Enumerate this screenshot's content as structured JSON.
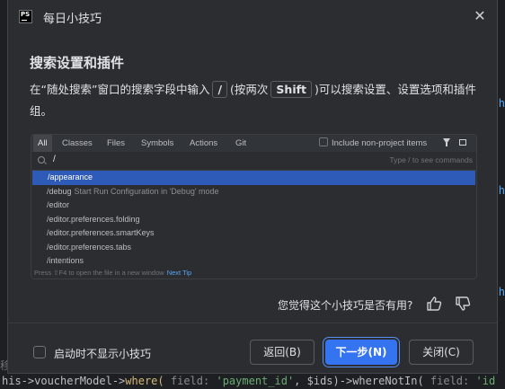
{
  "dialog": {
    "title": "每日小技巧",
    "app_logo": "PS",
    "close_icon": "close-icon"
  },
  "tip": {
    "heading": "搜索设置和插件",
    "desc_part1": "在“随处搜索”窗口的搜索字段中输入",
    "key_slash": "/",
    "desc_part2": "(按两次",
    "key_shift": "Shift",
    "desc_part3": ")可以搜索设置、设置选项和插件组。"
  },
  "preview": {
    "tabs": [
      "All",
      "Classes",
      "Files",
      "Symbols",
      "Actions",
      "Git"
    ],
    "include_label": "Include non-project items",
    "search_value": "/",
    "search_hint": "Type / to see commands",
    "results": [
      {
        "text": "/appearance",
        "sub": ""
      },
      {
        "text": "/debug",
        "sub": "Start Run Configuration in 'Debug' mode"
      },
      {
        "text": "/editor",
        "sub": ""
      },
      {
        "text": "/editor.preferences.folding",
        "sub": ""
      },
      {
        "text": "/editor.preferences.smartKeys",
        "sub": ""
      },
      {
        "text": "/editor.preferences.tabs",
        "sub": ""
      },
      {
        "text": "/intentions",
        "sub": ""
      }
    ],
    "footer_text": "Press ⇧F4 to open the file in a new window",
    "footer_link": "Next Tip"
  },
  "feedback": {
    "question": "您觉得这个小技巧是否有用?"
  },
  "footer": {
    "dont_show_label": "启动时不显示小技巧",
    "back_label": "返回(B)",
    "next_label": "下一步(N)",
    "close_label": "关闭(C)"
  },
  "background": {
    "code_prefix": "his->voucherModel->",
    "code_where": "where(",
    "code_hint1": "field:",
    "code_str": "'payment_id'",
    "code_mid": ", $ids)->whereNotIn(",
    "code_hint2": "field:",
    "code_tail": "'id"
  }
}
